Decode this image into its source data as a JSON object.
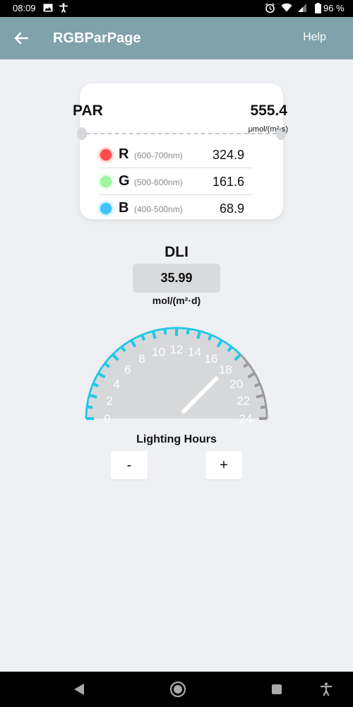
{
  "status_bar": {
    "time": "08:09",
    "battery": "96 %",
    "icons": [
      "image-icon",
      "accessibility-icon",
      "alarm-icon",
      "wifi-icon",
      "signal-icon",
      "battery-icon"
    ]
  },
  "app_bar": {
    "title": "RGBParPage",
    "help": "Help"
  },
  "par": {
    "label": "PAR",
    "value": "555.4",
    "unit": "μmol/(m²·s)",
    "rows": [
      {
        "letter": "R",
        "range": "(600-700nm)",
        "value": "324.9",
        "color": "#ff4b4b"
      },
      {
        "letter": "G",
        "range": "(500-600nm)",
        "value": "161.6",
        "color": "#9ef59a"
      },
      {
        "letter": "B",
        "range": "(400-500nm)",
        "value": "68.9",
        "color": "#3fc3ff"
      }
    ]
  },
  "dli": {
    "label": "DLI",
    "value": "35.99",
    "unit": "mol/(m²·d)"
  },
  "gauge": {
    "min": 0,
    "max": 24,
    "tick_labels": [
      "0",
      "2",
      "4",
      "6",
      "8",
      "10",
      "12",
      "14",
      "16",
      "18",
      "20",
      "22",
      "24"
    ],
    "value": 18,
    "active_color": "#22c7e6",
    "inactive_color": "#9a9a9a",
    "face_color": "#d7d8da"
  },
  "lighting": {
    "label": "Lighting Hours",
    "minus": "-",
    "plus": "+"
  },
  "colors": {
    "app_bar": "#7fa2ab",
    "background": "#eef0f3"
  }
}
